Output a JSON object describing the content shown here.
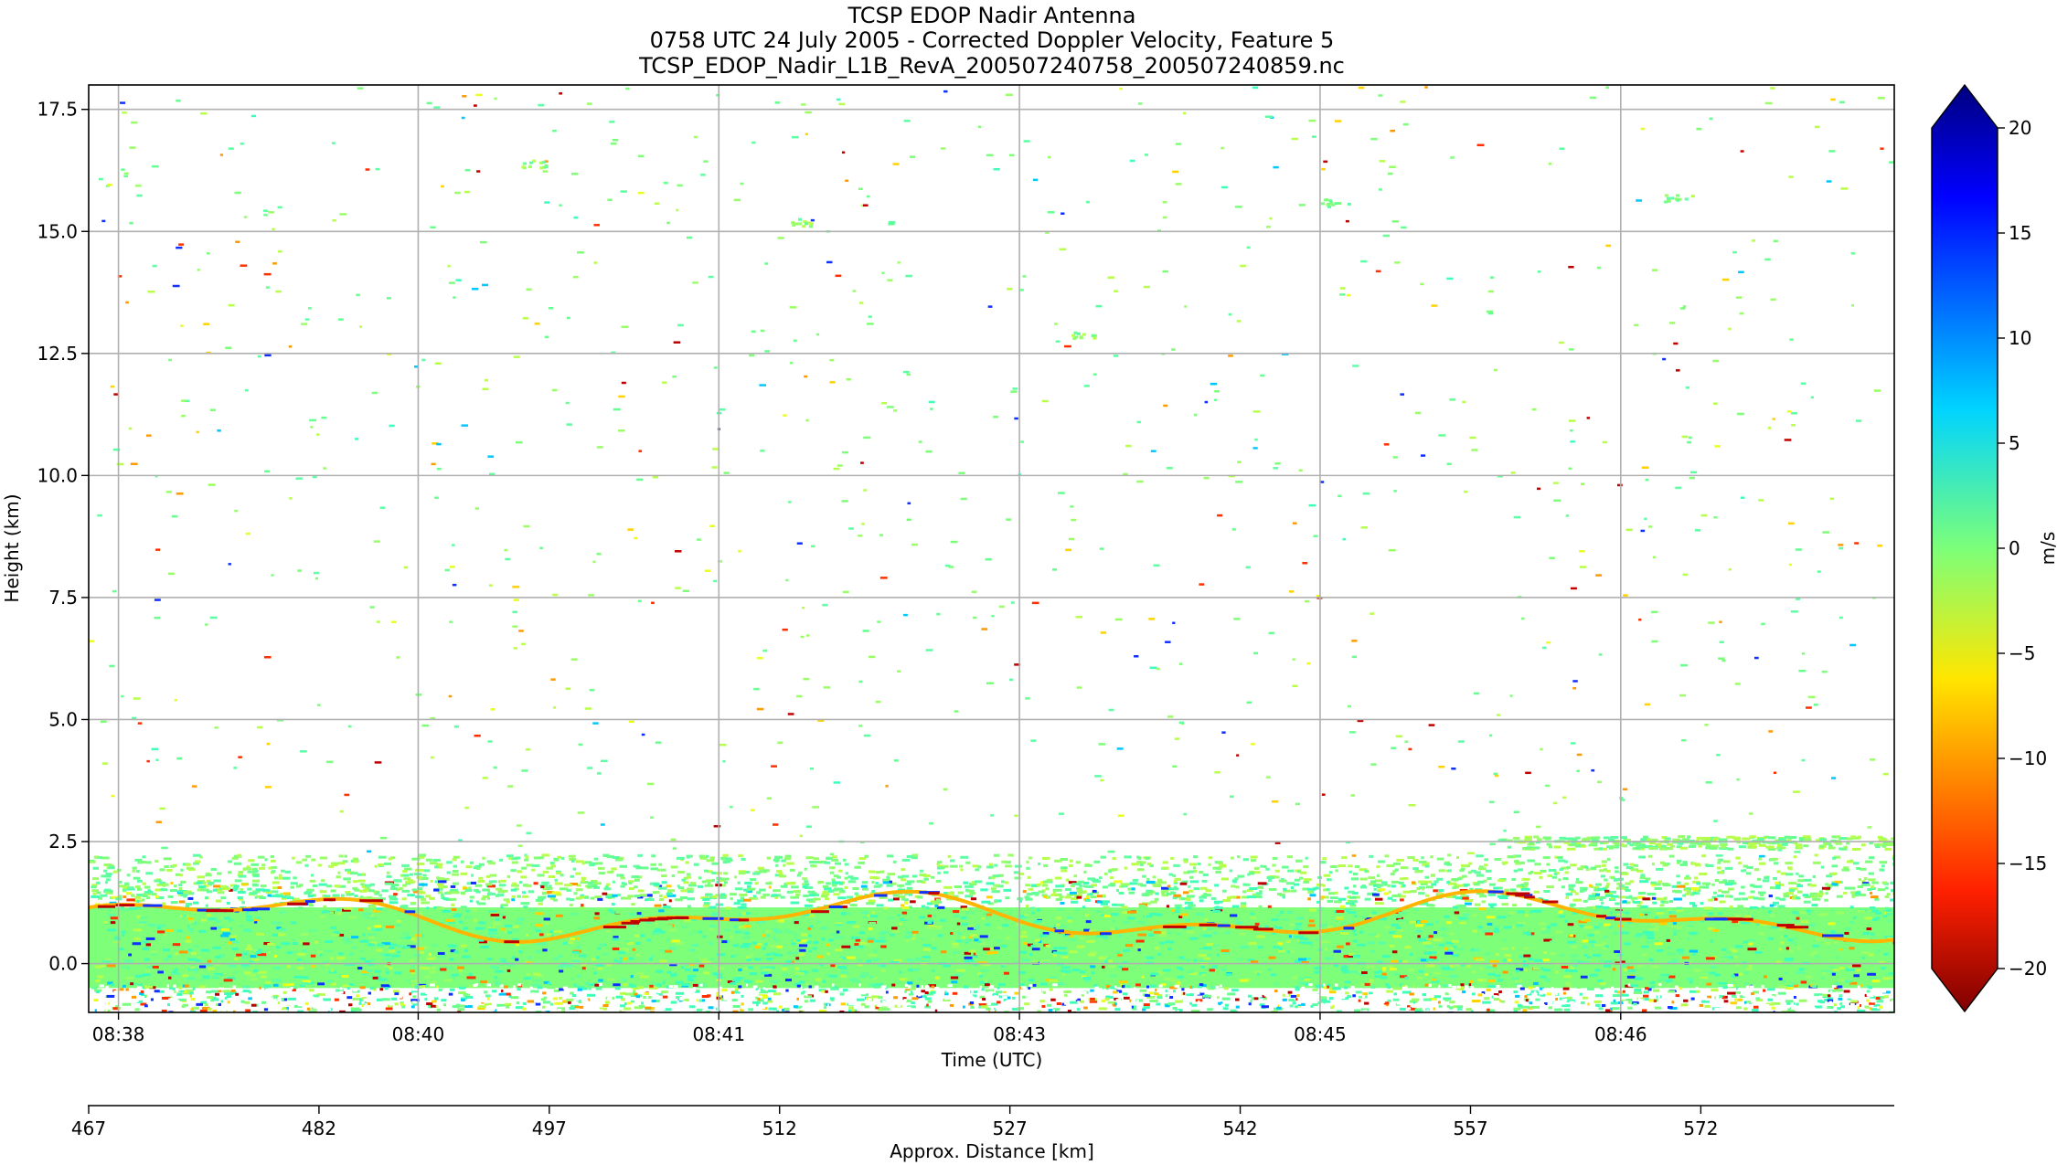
{
  "chart_data": {
    "type": "heatmap",
    "title_lines": [
      "TCSP EDOP Nadir Antenna",
      "0758 UTC 24 July 2005 - Corrected Doppler Velocity, Feature 5",
      "TCSP_EDOP_Nadir_L1B_RevA_200507240758_200507240859.nc"
    ],
    "xlabel": "Time (UTC)",
    "ylabel": "Height (km)",
    "x_ticks": [
      "08:38",
      "08:40",
      "08:41",
      "08:43",
      "08:45",
      "08:46"
    ],
    "y_ticks": [
      "0.0",
      "2.5",
      "5.0",
      "7.5",
      "10.0",
      "12.5",
      "15.0",
      "17.5"
    ],
    "ylim": [
      -1.0,
      18.0
    ],
    "grid": true,
    "secondary_x": {
      "label": "Approx. Distance [km]",
      "ticks": [
        "467",
        "482",
        "497",
        "512",
        "527",
        "542",
        "557",
        "572"
      ]
    },
    "colorbar": {
      "label": "m/s",
      "ticks": [
        "20",
        "15",
        "10",
        "5",
        "0",
        "−10",
        "−5",
        "−15",
        "−20"
      ],
      "tick_values": [
        20,
        15,
        10,
        5,
        0,
        -10,
        -5,
        -15,
        -20
      ],
      "range": [
        -20,
        20
      ],
      "extend": "both",
      "colormap": "jet_r"
    },
    "features": {
      "surface_echo_top_km": 1.9,
      "surface_echo_base_km": -1.0,
      "velocity_range_m_s": [
        -20,
        20
      ],
      "bright_band_km": [
        0.6,
        1.3
      ],
      "upper_scatter_top_km": 18.0
    },
    "colors": {
      "main_green": "#7dff7a",
      "cyan": "#3fffb8",
      "yellow": "#ffd200",
      "red": "#c00000",
      "blue": "#1030ff"
    }
  }
}
